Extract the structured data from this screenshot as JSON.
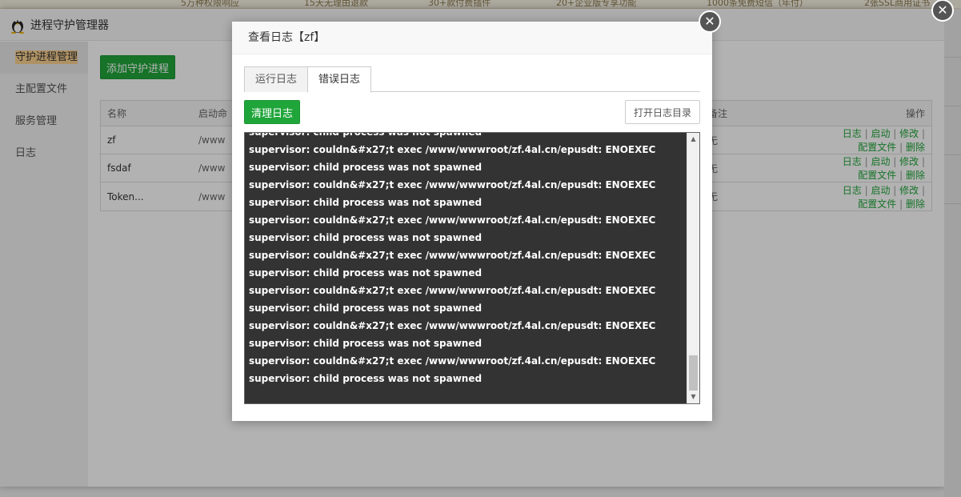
{
  "promo": [
    "5万种权限响应",
    "15天无理由退款",
    "30+款付费插件",
    "20+企业版专享功能",
    "1000条免费短信（年付）",
    "2张SSL商用证书"
  ],
  "app": {
    "title": "进程守护管理器",
    "sidebar": [
      "守护进程管理",
      "主配置文件",
      "服务管理",
      "日志"
    ],
    "add_button": "添加守护进程",
    "table": {
      "headers": {
        "name": "名称",
        "cmd": "启动命",
        "note": "备注",
        "op": "操作"
      },
      "rows": [
        {
          "name": "zf",
          "cmd": "/www",
          "note": "无"
        },
        {
          "name": "fsdaf",
          "cmd": "/www",
          "note": "无"
        },
        {
          "name": "Token...",
          "cmd": "/www",
          "note": "无"
        }
      ],
      "ops": [
        "日志",
        "启动",
        "修改",
        "配置文件",
        "删除"
      ]
    }
  },
  "modal": {
    "title": "查看日志【zf】",
    "tabs": [
      "运行日志",
      "错误日志"
    ],
    "clear_button": "清理日志",
    "open_dir_button": "打开日志目录",
    "log_lines": [
      "supervisor: child process was not spawned",
      "supervisor: couldn&#x27;t exec /www/wwwroot/zf.4al.cn/epusdt: ENOEXEC",
      "supervisor: child process was not spawned",
      "supervisor: couldn&#x27;t exec /www/wwwroot/zf.4al.cn/epusdt: ENOEXEC",
      "supervisor: child process was not spawned",
      "supervisor: couldn&#x27;t exec /www/wwwroot/zf.4al.cn/epusdt: ENOEXEC",
      "supervisor: child process was not spawned",
      "supervisor: couldn&#x27;t exec /www/wwwroot/zf.4al.cn/epusdt: ENOEXEC",
      "supervisor: child process was not spawned",
      "supervisor: couldn&#x27;t exec /www/wwwroot/zf.4al.cn/epusdt: ENOEXEC",
      "supervisor: child process was not spawned",
      "supervisor: couldn&#x27;t exec /www/wwwroot/zf.4al.cn/epusdt: ENOEXEC",
      "supervisor: child process was not spawned",
      "supervisor: couldn&#x27;t exec /www/wwwroot/zf.4al.cn/epusdt: ENOEXEC",
      "supervisor: child process was not spawned"
    ]
  },
  "icons": {
    "close": "close-icon",
    "tux": "tux-icon"
  },
  "colors": {
    "accent": "#20a53a",
    "active_highlight": "#fbd190",
    "log_bg": "#333333"
  }
}
